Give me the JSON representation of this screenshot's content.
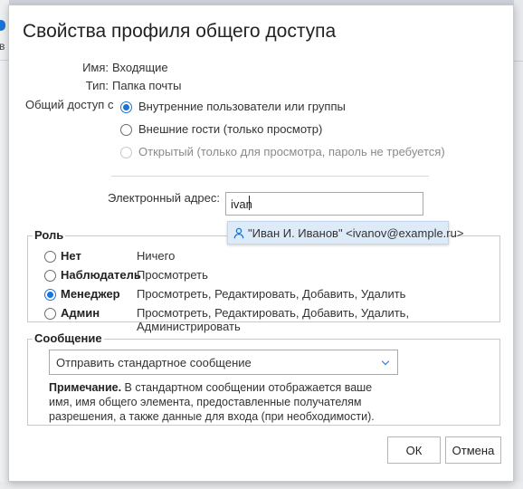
{
  "dialog": {
    "title": "Свойства профиля общего доступа",
    "name_label": "Имя:",
    "name_value": "Входящие",
    "type_label": "Тип:",
    "type_value": "Папка почты",
    "share_with_label": "Общий доступ с",
    "share_options": [
      {
        "label": "Внутренние пользователи или группы",
        "selected": true,
        "disabled": false
      },
      {
        "label": "Внешние гости (только просмотр)",
        "selected": false,
        "disabled": false
      },
      {
        "label": "Открытый (только для просмотра, пароль не требуется)",
        "selected": false,
        "disabled": true
      }
    ],
    "email_label": "Электронный адрес:",
    "email_value": "ivan",
    "suggestion": "\"Иван И. Иванов\" <ivanov@example.ru>",
    "role_legend": "Роль",
    "roles": [
      {
        "name": "Нет",
        "desc": "Ничего",
        "selected": false
      },
      {
        "name": "Наблюдатель",
        "desc": "Просмотреть",
        "selected": false
      },
      {
        "name": "Менеджер",
        "desc": "Просмотреть, Редактировать, Добавить, Удалить",
        "selected": true
      },
      {
        "name": "Админ",
        "desc": "Просмотреть, Редактировать, Добавить, Удалить, Администрировать",
        "selected": false
      }
    ],
    "message_legend": "Сообщение",
    "message_select": "Отправить стандартное сообщение",
    "note_bold": "Примечание.",
    "note_text": " В стандартном сообщении отображается ваше имя, имя общего элемента, предоставленные получателям разрешения, а также данные для входа (при необходимости).",
    "ok_label": "ОК",
    "cancel_label": "Отмена"
  },
  "colors": {
    "accent": "#1a73d9",
    "suggestion_bg": "#ddeaf8"
  },
  "background": {
    "left_glyph": "в"
  }
}
